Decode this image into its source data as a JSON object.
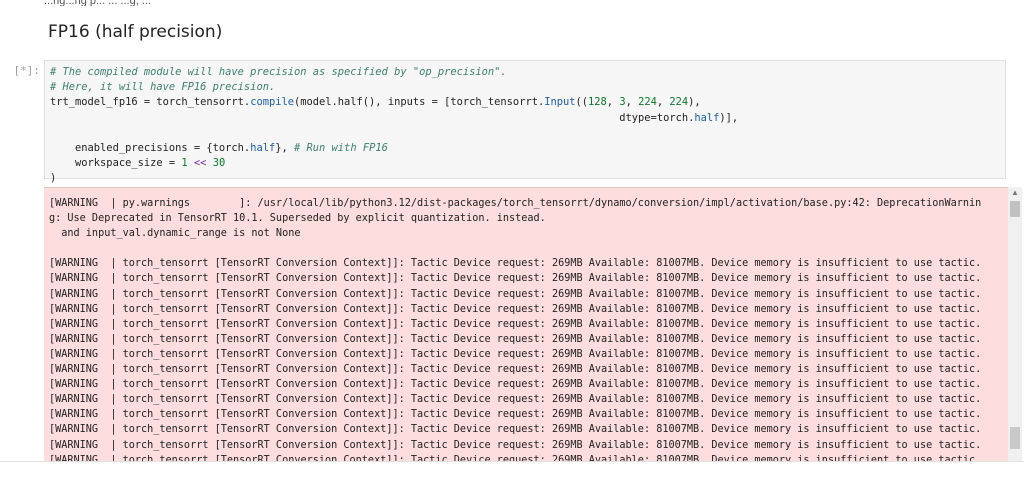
{
  "cell_top_text": "...ng...ng p... ... ...g, ...",
  "heading": "FP16 (half precision)",
  "prompt": "[*]:",
  "code": {
    "comment1": "# The compiled module will have precision as specified by \"op_precision\".",
    "comment2": "# Here, it will have FP16 precision.",
    "line3_a": "trt_model_fp16 = torch_tensorrt.",
    "line3_fn": "compile",
    "line3_b": "(model.half(), inputs = [torch_tensorrt.",
    "line3_fn2": "Input",
    "line3_c": "((",
    "n128": "128",
    "n3": "3",
    "n224a": "224",
    "n224b": "224",
    "line3_end": "),",
    "line4_a": "dtype=torch.",
    "line4_fn": "half",
    "line4_b": ")],",
    "line6_a": "enabled_precisions = {torch.",
    "line6_fn": "half",
    "line6_b": "}, ",
    "line6_cm": "# Run with FP16",
    "line7_a": "workspace_size = ",
    "n1": "1",
    "shift": "<<",
    "n30": "30",
    "close": ")"
  },
  "output": {
    "first_line_1": "[WARNING  | py.warnings        ]: /usr/local/lib/python3.12/dist-packages/torch_tensorrt/dynamo/conversion/impl/activation/base.py:42: DeprecationWarnin",
    "first_line_2": "g: Use Deprecated in TensorRT 10.1. Superseded by explicit quantization. instead.",
    "first_line_3": "  and input_val.dynamic_range is not None",
    "repeated_warning": "[WARNING  | torch_tensorrt [TensorRT Conversion Context]]: Tactic Device request: 269MB Available: 81007MB. Device memory is insufficient to use tactic.",
    "repeat_count": 14
  },
  "scrollbar": {
    "up_icon": "triangle-up-icon"
  }
}
